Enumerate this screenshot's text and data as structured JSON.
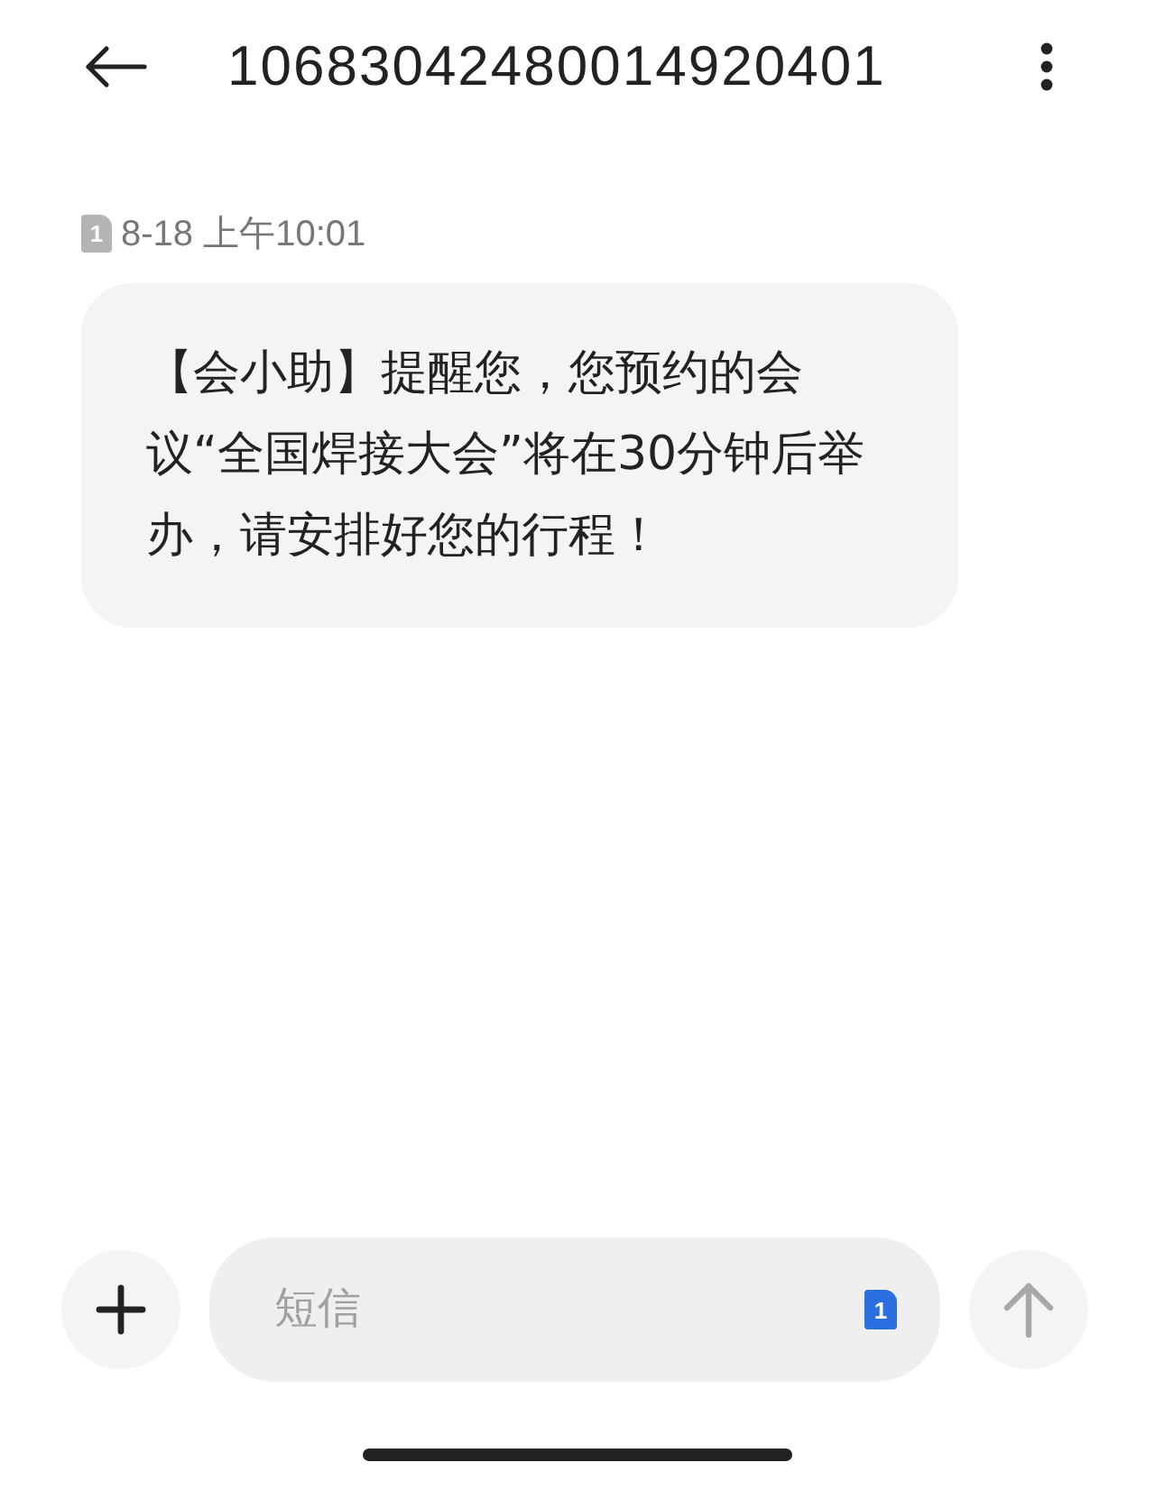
{
  "header": {
    "title": "10683042480014920401"
  },
  "messages": [
    {
      "sim": "1",
      "time": "8-18 上午10:01",
      "text": "【会小助】提醒您，您预约的会议“全国焊接大会”将在30分钟后举办，请安排好您的行程！"
    }
  ],
  "composer": {
    "placeholder": "短信",
    "sim": "1"
  }
}
